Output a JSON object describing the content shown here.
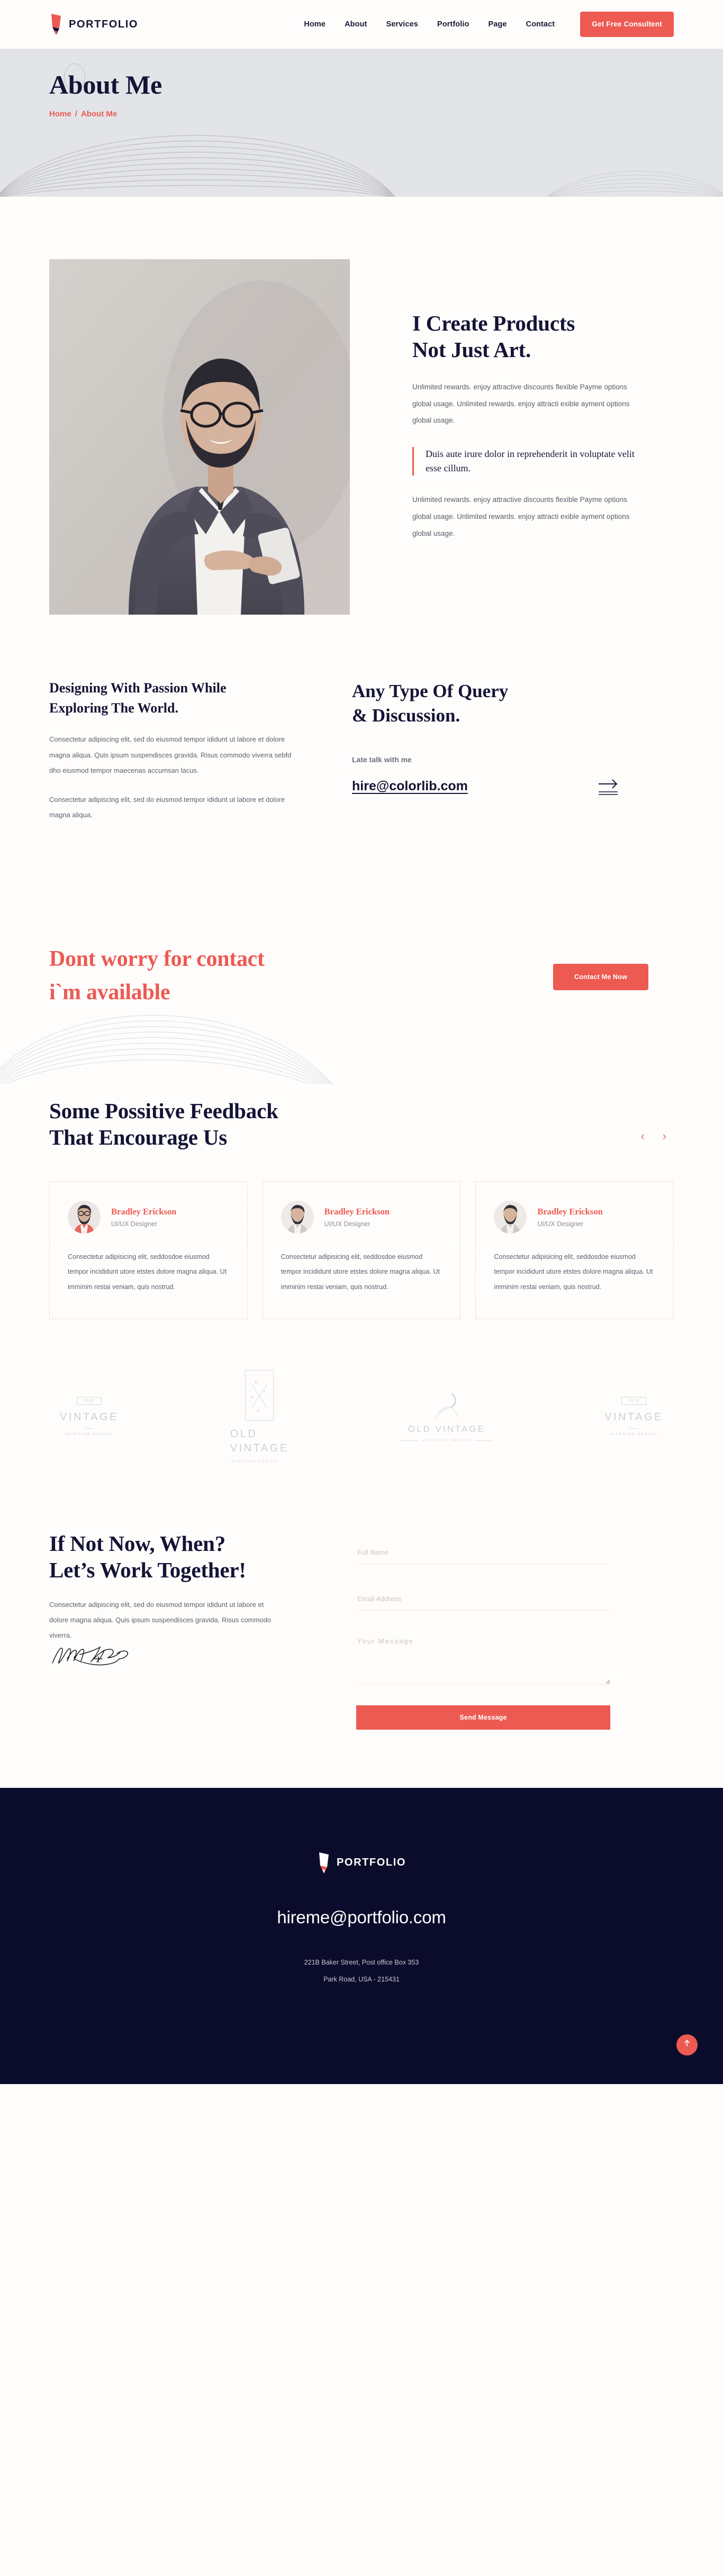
{
  "brand": {
    "name": "PORTFOLIO",
    "accent": "#EC5A52",
    "dark": "#141436",
    "footer_bg": "#0B0B2B",
    "hero_bg": "#E2E4E8",
    "page_bg": "#FFFDFB"
  },
  "header": {
    "nav": [
      {
        "label": "Home"
      },
      {
        "label": "About"
      },
      {
        "label": "Services"
      },
      {
        "label": "Portfolio"
      },
      {
        "label": "Page"
      },
      {
        "label": "Contact"
      }
    ],
    "cta_label": "Get Free Consultent"
  },
  "hero": {
    "title": "About Me",
    "breadcrumb_home": "Home",
    "breadcrumb_sep": "/",
    "breadcrumb_current": "About Me"
  },
  "about": {
    "title": "I Create Products\nNot Just Art.",
    "title_line1": "I Create Products",
    "title_line2": "Not Just Art.",
    "paragraph1": "Unlimited rewards. enjoy attractive discounts flexible Payme options global usage. Unlimited rewards. enjoy attracti exible ayment options global usage.",
    "quote": "Duis aute irure dolor in reprehenderit in voluptate velit esse cillum.",
    "paragraph2": "Unlimited rewards. enjoy attractive discounts flexible Payme options global usage. Unlimited rewards. enjoy attracti exible ayment options global usage.",
    "photo_alt": "Portrait of a bearded man in a suit with glasses holding a smartphone"
  },
  "designing": {
    "title_line1": "Designing With Passion While",
    "title_line2": "Exploring The World.",
    "paragraph1": "Consectetur adipiscing elit, sed do eiusmod tempor ididunt ut labore et dolore magna aliqua. Quis ipsum suspendisces gravida. Risus commodo viverra sebfd dho eiusmod tempor maecenas accumsan lacus.",
    "paragraph2": "Consectetur adipiscing elit, sed do eiusmod tempor ididunt ut labore et dolore magna aliqua."
  },
  "query": {
    "title_line1": "Any Type Of Query",
    "title_line2": "& Discussion.",
    "label": "Late talk with me",
    "email": "hire@colorlib.com"
  },
  "cta": {
    "title_line1": "Dont worry for contact",
    "title_line2": "i`m available",
    "button_label": "Contact Me Now"
  },
  "testimonials": {
    "title_line1": "Some Possitive Feedback",
    "title_line2": "That Encourage Us",
    "prev_glyph": "‹",
    "next_glyph": "›",
    "items": [
      {
        "name": "Bradley Erickson",
        "role": "UI/UX Designer",
        "body": "Consectetur adipisicing elit, seddosdoe eiusmod tempor incididunt utore etstes dolore magna aliqua. Ut imminim restai veniam, quis nostrud."
      },
      {
        "name": "Bradley Erickson",
        "role": "UI/UX Designer",
        "body": "Consectetur adipisicing elit, seddosdoe eiusmod tempor incididunt utore etstes dolore magna aliqua. Ut imminim restai veniam, quis nostrud."
      },
      {
        "name": "Bradley Erickson",
        "role": "UI/UX Designer",
        "body": "Consectetur adipisicing elit, seddosdoe eiusmod tempor incididunt utore etstes dolore magna aliqua. Ut imminim restai veniam, quis nostrud."
      }
    ]
  },
  "brands": [
    {
      "style": "boxed",
      "tag": "OLD",
      "name": "VINTAGE",
      "sub": "INTERIOR DESIGN"
    },
    {
      "style": "framed",
      "tag": "E H J A",
      "name_line1": "OLD",
      "name_line2": "VINTAGE",
      "sub": "INTERIOR DESIGN"
    },
    {
      "style": "chair",
      "name": "OLD VINTAGE",
      "sub": "INTERIOR DESIGN"
    },
    {
      "style": "boxed",
      "tag": "OLD",
      "name": "VINTAGE",
      "sub": "INTERIOR DESIGN"
    }
  ],
  "contact": {
    "title_line1": "If Not Now, When?",
    "title_line2": "Let’s Work Together!",
    "paragraph": "Consectetur adipiscing elit, sed do eiusmod tempor ididunt ut labore et dolore magna aliqua. Quis ipsum suspendisces gravida. Risus commodo viverra.",
    "signature_alt": "John Hancock handwritten signature",
    "fields": {
      "name_placeholder": "Full Name",
      "name_value": "",
      "email_placeholder": "Email Address",
      "email_value": "",
      "message_placeholder": "Your Message",
      "message_value": ""
    },
    "submit_label": "Send Message"
  },
  "footer": {
    "logo_text": "PORTFOLIO",
    "email": "hireme@portfolio.com",
    "address_line1": "221B Baker Street, Post office Box 353",
    "address_line2": "Park Road, USA - 215431"
  }
}
